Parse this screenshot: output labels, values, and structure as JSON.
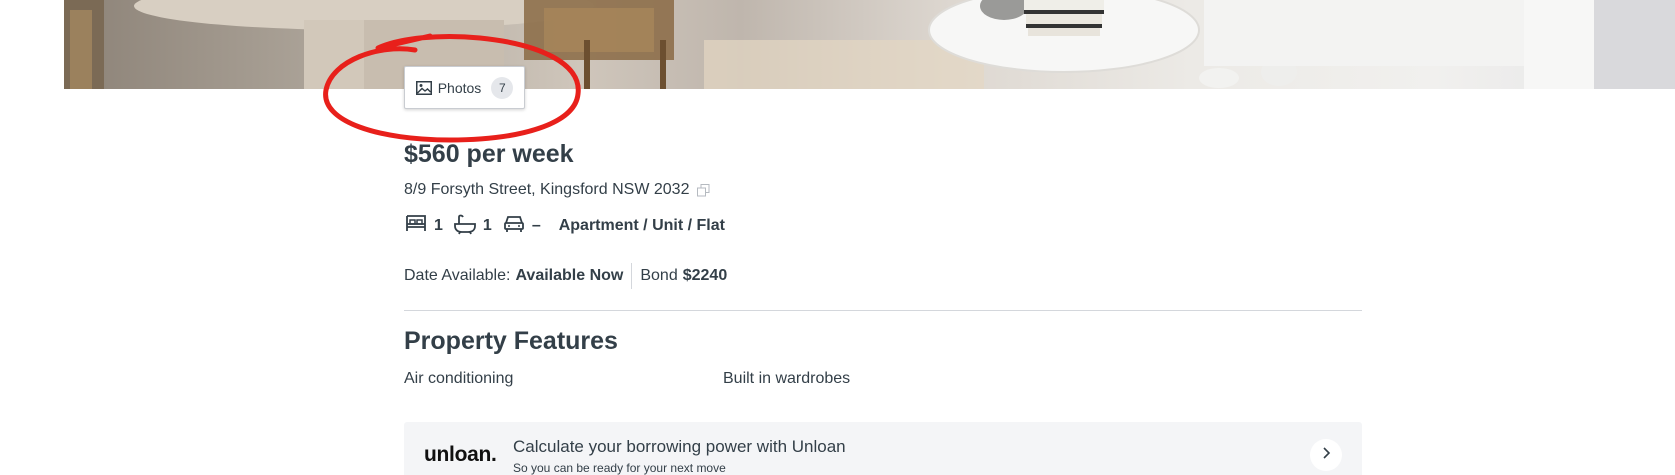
{
  "hero": {
    "photos_label": "Photos",
    "photos_count": "7"
  },
  "listing": {
    "price": "$560 per week",
    "address": "8/9 Forsyth Street, Kingsford NSW 2032",
    "bedrooms": "1",
    "bathrooms": "1",
    "parking": "–",
    "property_type": "Apartment / Unit / Flat",
    "date_available_label": "Date Available:",
    "date_available_value": "Available Now",
    "bond_label": "Bond",
    "bond_value": "$2240"
  },
  "features": {
    "title": "Property Features",
    "items": [
      "Air conditioning",
      "Built in wardrobes"
    ]
  },
  "unloan": {
    "logo": "unloan.",
    "title": "Calculate your borrowing power with Unloan",
    "subtitle": "So you can be ready for your next move"
  },
  "colors": {
    "text": "#333f48",
    "annotation": "#e8201b",
    "card_bg": "#f4f5f7",
    "divider": "#d4d7dc"
  },
  "icons": {
    "photos": "picture-icon",
    "bed": "bed-icon",
    "bath": "bath-icon",
    "car": "car-icon",
    "copy": "copy-icon",
    "chevron": "chevron-right-icon"
  }
}
